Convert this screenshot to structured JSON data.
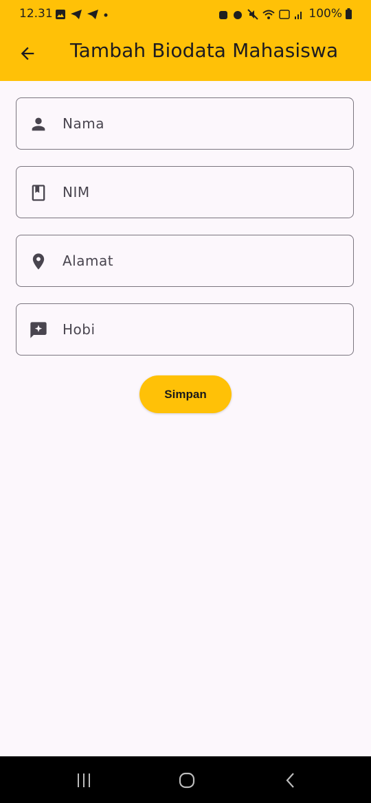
{
  "status_bar": {
    "time": "12.31",
    "battery": "100%"
  },
  "app_bar": {
    "title": "Tambah Biodata Mahasiswa",
    "back_icon": "arrow-back-icon"
  },
  "form": {
    "fields": [
      {
        "placeholder": "Nama",
        "icon": "person-icon"
      },
      {
        "placeholder": "NIM",
        "icon": "bookmark-book-icon"
      },
      {
        "placeholder": "Alamat",
        "icon": "location-pin-icon"
      },
      {
        "placeholder": "Hobi",
        "icon": "chat-sparkle-icon"
      }
    ],
    "submit_label": "Simpan"
  },
  "colors": {
    "accent": "#ffc107",
    "background": "#fcf7fc",
    "outline": "#79747e",
    "icon": "#49454f"
  },
  "nav_bar": {
    "buttons": [
      "recent-apps-icon",
      "home-icon",
      "back-icon"
    ]
  }
}
